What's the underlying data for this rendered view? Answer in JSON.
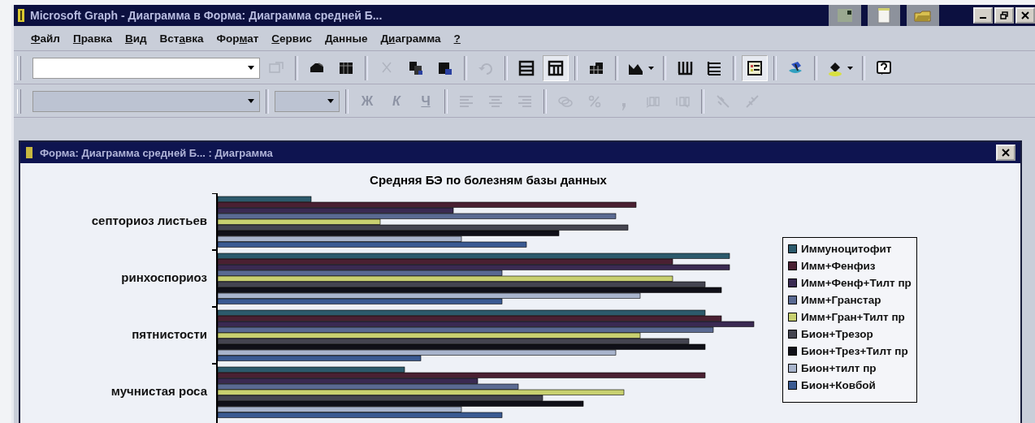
{
  "window": {
    "title": "Microsoft Graph - Диаграмма в Форма: Диаграмма средней Б..."
  },
  "menu": [
    {
      "key": "Ф",
      "post": "айл"
    },
    {
      "key": "П",
      "post": "равка"
    },
    {
      "key": "В",
      "post": "ид"
    },
    {
      "pre": "Вст",
      "key": "а",
      "post": "вка"
    },
    {
      "pre": "Фор",
      "key": "м",
      "post": "ат"
    },
    {
      "key": "С",
      "post": "ервис"
    },
    {
      "key": "Д",
      "post": "анные"
    },
    {
      "pre": "Д",
      "key": "и",
      "post": "аграмма"
    },
    {
      "key": "?"
    }
  ],
  "toolbar_1": {
    "object_field": {
      "disabled": false
    },
    "buttons": [
      {
        "kind": "format",
        "disabled": true,
        "pressed": false
      },
      {
        "kind": "separator"
      },
      {
        "kind": "import",
        "disabled": false,
        "pressed": false
      },
      {
        "kind": "datasheet",
        "disabled": false,
        "pressed": false
      },
      {
        "kind": "separator"
      },
      {
        "kind": "cut",
        "disabled": true,
        "pressed": false
      },
      {
        "kind": "copy",
        "disabled": false,
        "pressed": false
      },
      {
        "kind": "paste",
        "disabled": false,
        "pressed": false
      },
      {
        "kind": "separator"
      },
      {
        "kind": "undo",
        "disabled": true,
        "pressed": false
      },
      {
        "kind": "separator"
      },
      {
        "kind": "by-row",
        "disabled": false,
        "pressed": false
      },
      {
        "kind": "by-column",
        "disabled": false,
        "pressed": true
      },
      {
        "kind": "separator"
      },
      {
        "kind": "data-table",
        "disabled": false,
        "pressed": false
      },
      {
        "kind": "separator"
      },
      {
        "kind": "chart-type",
        "disabled": false,
        "pressed": false,
        "dropdown": true
      },
      {
        "kind": "separator"
      },
      {
        "kind": "category-gridlines",
        "disabled": false,
        "pressed": false
      },
      {
        "kind": "value-gridlines",
        "disabled": false,
        "pressed": false
      },
      {
        "kind": "separator"
      },
      {
        "kind": "legend",
        "disabled": false,
        "pressed": true
      },
      {
        "kind": "separator"
      },
      {
        "kind": "drawing",
        "disabled": false,
        "pressed": false
      },
      {
        "kind": "separator"
      },
      {
        "kind": "fill",
        "disabled": false,
        "pressed": false,
        "dropdown": true
      },
      {
        "kind": "separator"
      },
      {
        "kind": "help",
        "disabled": false,
        "pressed": false
      }
    ]
  },
  "toolbar_2": {
    "font_field": {
      "disabled": true
    },
    "size_field": {
      "disabled": true
    },
    "buttons": [
      {
        "kind": "text",
        "label": "Ж",
        "disabled": true
      },
      {
        "kind": "text",
        "label": "К",
        "disabled": true
      },
      {
        "kind": "text",
        "label": "Ч",
        "disabled": true
      },
      {
        "kind": "separator"
      },
      {
        "kind": "align-left",
        "disabled": true
      },
      {
        "kind": "align-center",
        "disabled": true
      },
      {
        "kind": "align-right",
        "disabled": true
      },
      {
        "kind": "separator"
      },
      {
        "kind": "currency",
        "disabled": true
      },
      {
        "kind": "percent",
        "disabled": true
      },
      {
        "kind": "comma",
        "disabled": true
      },
      {
        "kind": "increase-decimal",
        "disabled": true
      },
      {
        "kind": "decrease-decimal",
        "disabled": true
      },
      {
        "kind": "separator"
      },
      {
        "kind": "rotate-down",
        "disabled": true
      },
      {
        "kind": "rotate-up",
        "disabled": true
      }
    ]
  },
  "chart_window": {
    "title": "Форма: Диаграмма средней Б... : Диаграмма",
    "chart": {
      "title": "Средняя БЭ по болезням базы данных",
      "categories": [
        "септориоз листьев",
        "ринхоспориоз",
        "пятнистости",
        "мучнистая роса"
      ],
      "legend": [
        {
          "label": "Иммуноцитофит",
          "color": "#2c5a6c"
        },
        {
          "label": "Имм+Фенфиз",
          "color": "#4a2032"
        },
        {
          "label": "Имм+Фенф+Тилт пр",
          "color": "#3a2a52"
        },
        {
          "label": "Имм+Гранстар",
          "color": "#5a6a92"
        },
        {
          "label": "Имм+Гран+Тилт пр",
          "color": "#c8d070"
        },
        {
          "label": "Бион+Трезор",
          "color": "#444450"
        },
        {
          "label": "Бион+Трез+Тилт пр",
          "color": "#101018"
        },
        {
          "label": "Бион+тилт пр",
          "color": "#a8b4cc"
        },
        {
          "label": "Бион+Ковбой",
          "color": "#3a5a92"
        }
      ]
    }
  }
}
